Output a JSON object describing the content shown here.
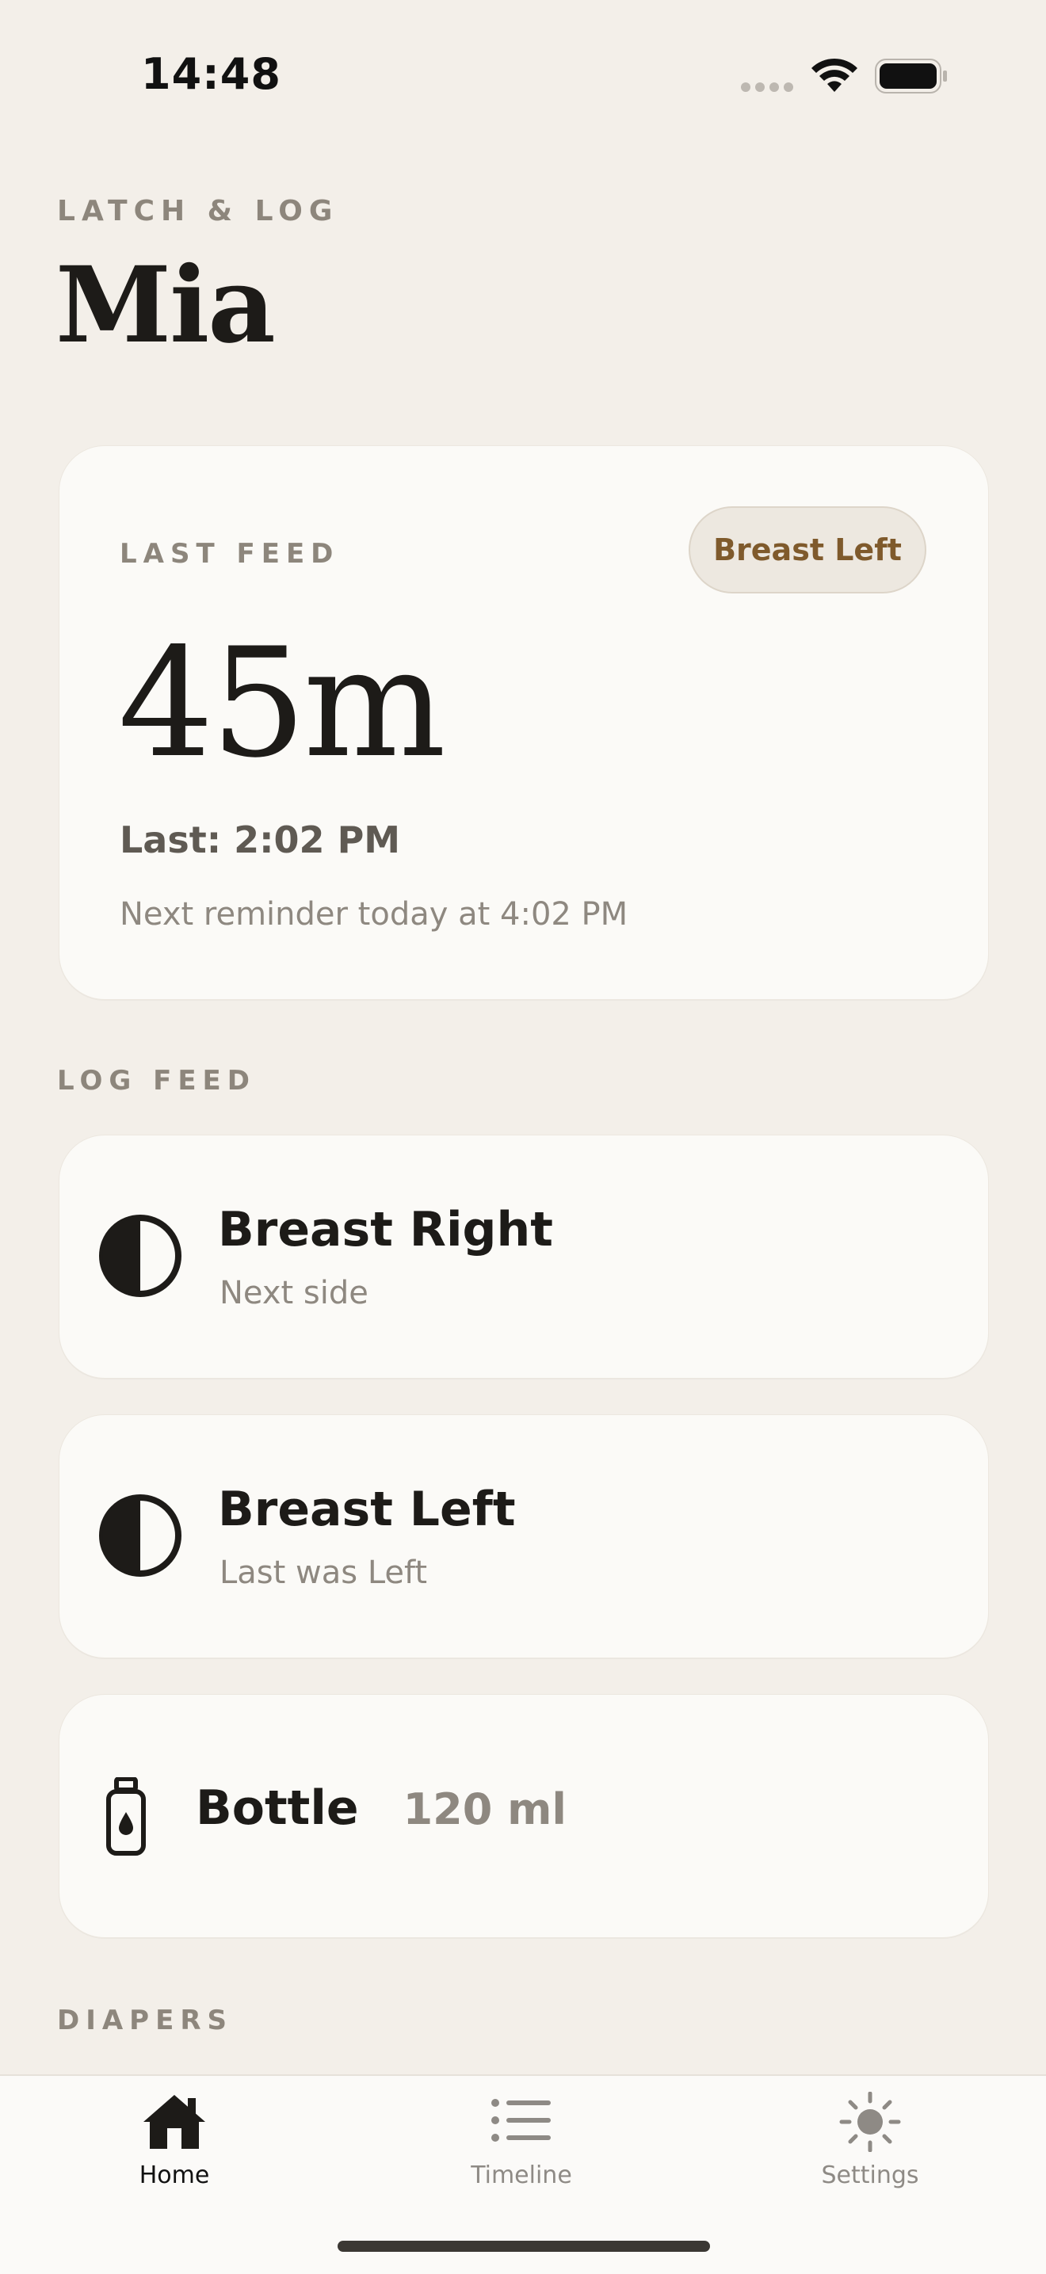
{
  "status_bar": {
    "time": "14:48"
  },
  "header": {
    "app_label": "LATCH & LOG",
    "baby_name": "Mia"
  },
  "last_feed": {
    "section_title": "LAST FEED",
    "side_badge": "Breast Left",
    "elapsed": "45m",
    "last_time": "Last: 2:02 PM",
    "next_reminder": "Next reminder today at 4:02 PM"
  },
  "log_feed": {
    "section_title": "LOG FEED",
    "options": [
      {
        "title": "Breast Right",
        "subtitle": "Next side",
        "icon": "half-circle-icon"
      },
      {
        "title": "Breast Left",
        "subtitle": "Last was Left",
        "icon": "half-circle-icon"
      },
      {
        "title": "Bottle",
        "amount": "120 ml",
        "icon": "bottle-icon"
      }
    ]
  },
  "diapers": {
    "section_title": "DIAPERS"
  },
  "tab_bar": {
    "tabs": [
      {
        "label": "Home",
        "icon": "house-icon",
        "active": true
      },
      {
        "label": "Timeline",
        "icon": "list-icon",
        "active": false
      },
      {
        "label": "Settings",
        "icon": "sun-icon",
        "active": false
      }
    ]
  },
  "colors": {
    "background": "#f3efe9",
    "card": "#fbfaf7",
    "accent": "#7f5a2c",
    "muted_text": "#8d867c"
  }
}
